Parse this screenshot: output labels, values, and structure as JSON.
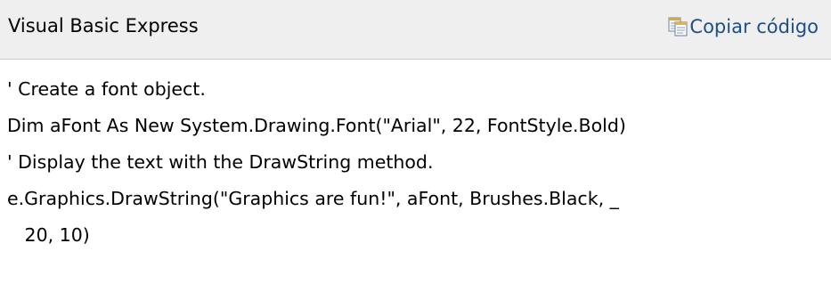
{
  "header": {
    "language": "Visual Basic Express",
    "copy_label": "Copiar código",
    "copy_icon": "copy-icon"
  },
  "code": {
    "lines": [
      "' Create a font object.",
      "Dim aFont As New System.Drawing.Font(\"Arial\", 22, FontStyle.Bold)",
      "' Display the text with the DrawString method.",
      "e.Graphics.DrawString(\"Graphics are fun!\", aFont, Brushes.Black, _",
      "   20, 10)"
    ]
  },
  "colors": {
    "header_background": "#efefef",
    "header_border": "#c8cdd4",
    "link": "#1b4f8a",
    "text": "#000000"
  }
}
